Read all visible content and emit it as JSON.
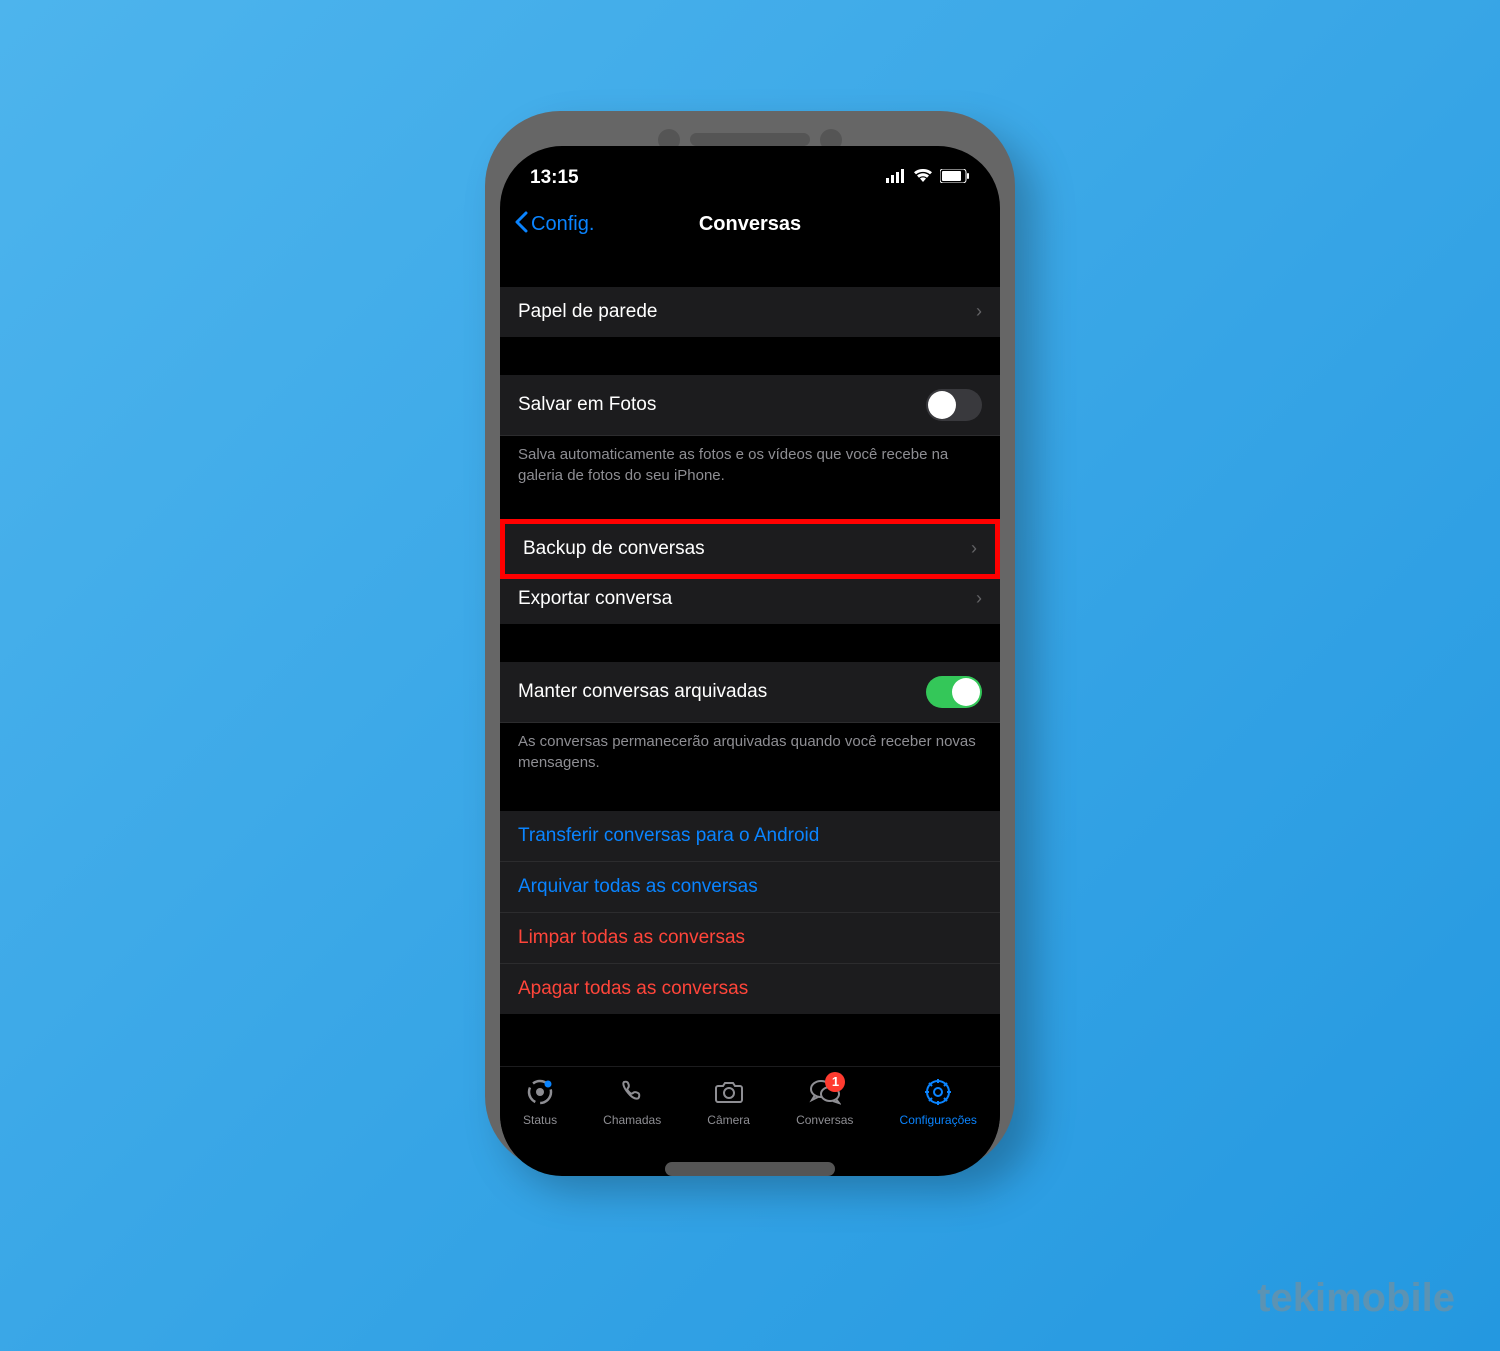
{
  "statusBar": {
    "time": "13:15"
  },
  "nav": {
    "back": "Config.",
    "title": "Conversas"
  },
  "rows": {
    "wallpaper": "Papel de parede",
    "savePhotos": "Salvar em Fotos",
    "savePhotosFooter": "Salva automaticamente as fotos e os vídeos que você recebe na galeria de fotos do seu iPhone.",
    "backup": "Backup de conversas",
    "export": "Exportar conversa",
    "keepArchived": "Manter conversas arquivadas",
    "keepArchivedFooter": "As conversas permanecerão arquivadas quando você receber novas mensagens.",
    "transferAndroid": "Transferir conversas para o Android",
    "archiveAll": "Arquivar todas as conversas",
    "clearAll": "Limpar todas as conversas",
    "deleteAll": "Apagar todas as conversas"
  },
  "tabs": {
    "status": "Status",
    "calls": "Chamadas",
    "camera": "Câmera",
    "chats": "Conversas",
    "settings": "Configurações",
    "badge": "1"
  },
  "watermark": "tekimobile"
}
